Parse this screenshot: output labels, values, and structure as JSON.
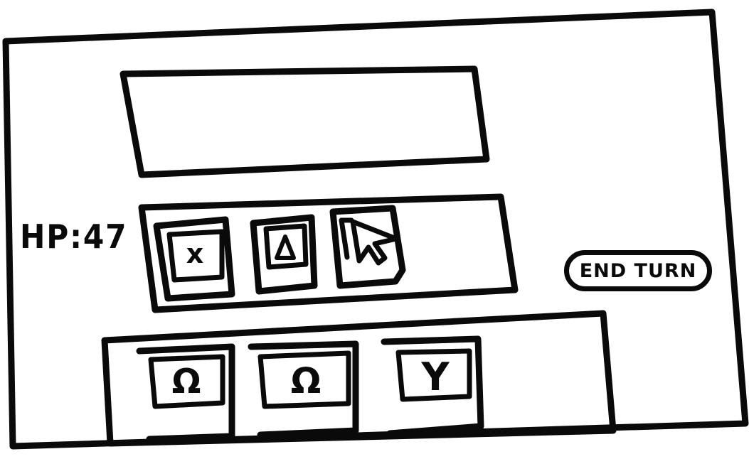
{
  "hud": {
    "hp_label": "HP:47"
  },
  "end_turn": {
    "label": "END TURN"
  },
  "action_bar": {
    "slots": [
      {
        "icon": "x-icon",
        "glyph": "x"
      },
      {
        "icon": "triangle-icon",
        "glyph": ""
      },
      {
        "icon": "cursor-icon",
        "glyph": ""
      }
    ]
  },
  "hand": {
    "cards": [
      {
        "icon": "omega-icon",
        "glyph": "Ω"
      },
      {
        "icon": "omega-icon",
        "glyph": "Ω"
      },
      {
        "icon": "y-icon",
        "glyph": "Y"
      }
    ]
  }
}
